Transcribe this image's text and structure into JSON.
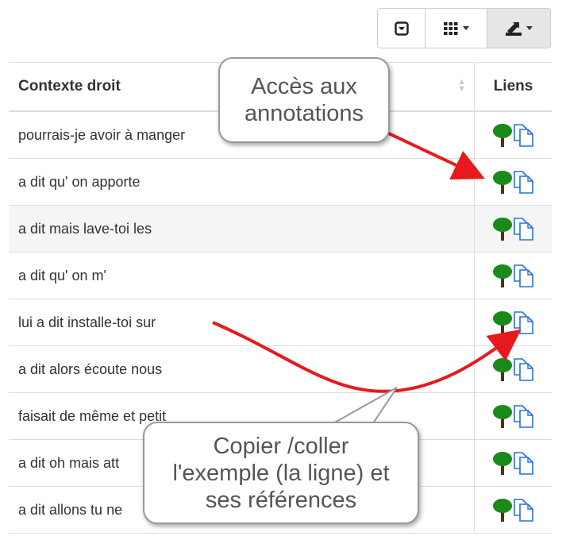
{
  "toolbar": {
    "buttons": [
      {
        "icon": "toggle-icon"
      },
      {
        "icon": "columns-grid-icon"
      },
      {
        "icon": "export-icon"
      }
    ]
  },
  "table": {
    "headers": {
      "context": "Contexte droit",
      "links": "Liens"
    },
    "rows": [
      {
        "context": "pourrais-je avoir à manger"
      },
      {
        "context": "a dit qu' on apporte"
      },
      {
        "context": "a dit mais lave-toi les"
      },
      {
        "context": "a dit qu' on m'"
      },
      {
        "context": "lui a dit installe-toi sur"
      },
      {
        "context": "a dit alors écoute nous"
      },
      {
        "context": "faisait de même et petit"
      },
      {
        "context": "a dit oh mais att"
      },
      {
        "context": "a dit allons tu ne"
      }
    ]
  },
  "callouts": {
    "annotations": {
      "line1": "Accès aux",
      "line2": "annotations"
    },
    "copy": {
      "line1": "Copier /coller",
      "line2": "l'exemple (la ligne) et",
      "line3": "ses références"
    }
  },
  "colors": {
    "arrow": "#e8191c",
    "tree": "#1a8a1a",
    "trunk": "#5a2d0c",
    "doc": "#2a6fdb"
  }
}
